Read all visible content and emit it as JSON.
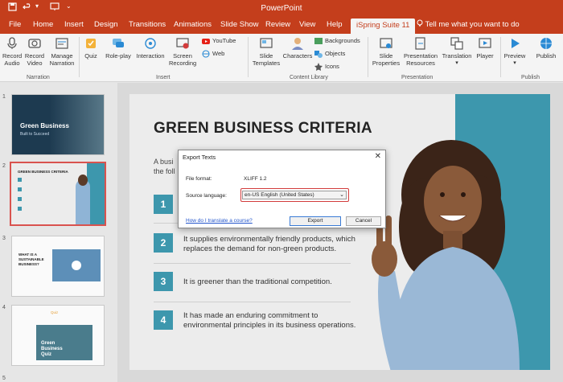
{
  "app": {
    "title": "PowerPoint"
  },
  "quick_access": {
    "save": "save-icon",
    "undo": "undo-icon",
    "redo": "redo-icon",
    "present": "present-icon",
    "customize": "chevron-down-icon"
  },
  "tabs": [
    "File",
    "Home",
    "Insert",
    "Design",
    "Transitions",
    "Animations",
    "Slide Show",
    "Review",
    "View",
    "Help",
    "iSpring Suite 11"
  ],
  "active_tab": "iSpring Suite 11",
  "tell_me": "Tell me what you want to do",
  "ribbon": {
    "narration": {
      "label": "Narration",
      "record_audio": "Record Audio",
      "record_video": "Record Video",
      "manage_narration": "Manage Narration"
    },
    "insert": {
      "label": "Insert",
      "quiz": "Quiz",
      "role_play": "Role-play",
      "interaction": "Interaction",
      "screen_recording": "Screen Recording",
      "youtube": "YouTube",
      "web": "Web"
    },
    "content_library": {
      "label": "Content Library",
      "slide_templates": "Slide Templates",
      "characters": "Characters",
      "backgrounds": "Backgrounds",
      "objects": "Objects",
      "icons": "Icons"
    },
    "presentation": {
      "label": "Presentation",
      "slide_properties": "Slide Properties",
      "presentation_resources": "Presentation Resources",
      "translation": "Translation",
      "player": "Player"
    },
    "publish": {
      "label": "Publish",
      "preview": "Preview",
      "publish": "Publish"
    }
  },
  "thumbnails": [
    {
      "num": "1",
      "title": "Green Business",
      "sub": "Built to Succeed"
    },
    {
      "num": "2",
      "title": "GREEN BUSINESS CRITERIA"
    },
    {
      "num": "3",
      "title": "WHAT IS A SUSTAINABLE BUSINESS?"
    },
    {
      "num": "4",
      "title": "Green Business Quiz",
      "badge": "Quiz"
    }
  ],
  "slide": {
    "title": "GREEN BUSINESS CRITERIA",
    "intro_line1": "A busi",
    "intro_line2": "the foll",
    "criteria": [
      {
        "num": "1",
        "text": ""
      },
      {
        "num": "2",
        "text": "It supplies environmentally friendly products, which replaces the demand for non-green products."
      },
      {
        "num": "3",
        "text": "It is greener than the traditional competition."
      },
      {
        "num": "4",
        "text": "It has made an enduring commitment to environmental principles in its business operations."
      }
    ]
  },
  "dialog": {
    "title": "Export Texts",
    "file_format_label": "File format:",
    "file_format_value": "XLIFF 1.2",
    "source_language_label": "Source language:",
    "source_language_value": "en-US English (United States)",
    "help_link": "How do I translate a course?",
    "export": "Export",
    "cancel": "Cancel"
  },
  "colors": {
    "brand": "#c43e1c",
    "accent": "#3d97ad",
    "highlight": "#d23b3b"
  }
}
